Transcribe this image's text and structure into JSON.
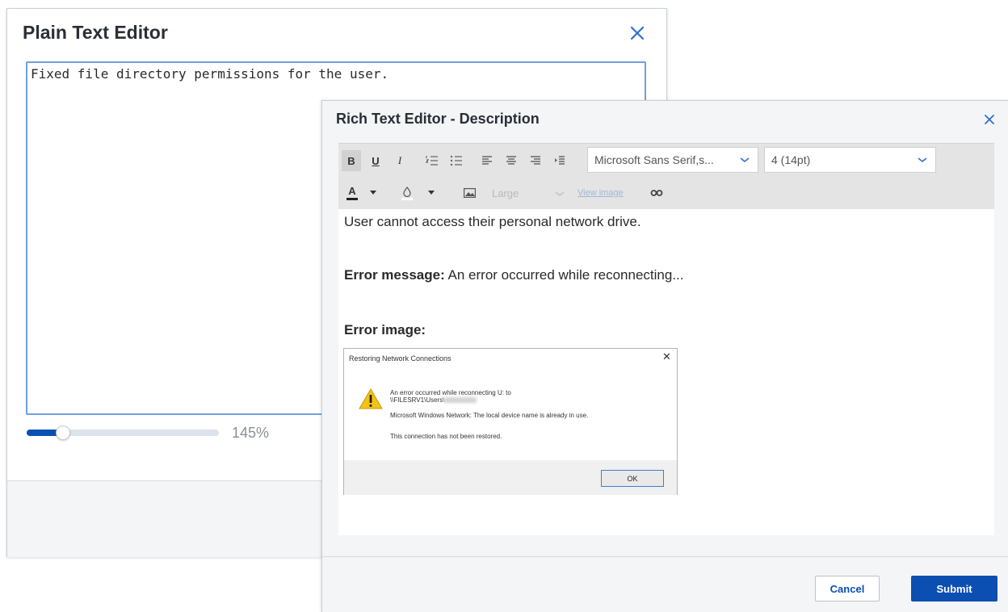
{
  "plain_editor": {
    "title": "Plain Text Editor",
    "text": "Fixed file directory permissions for the user.",
    "zoom": {
      "label": "145%",
      "slider_fraction": 0.19
    }
  },
  "rich_editor": {
    "title": "Rich Text Editor - Description",
    "toolbar": {
      "bold": "B",
      "underline": "U",
      "italic": "I",
      "font_family": "Microsoft Sans Serif,s...",
      "font_size": "4 (14pt)",
      "font_color": "A",
      "image_size": "Large",
      "view_image": "View image"
    },
    "body": {
      "line1": "User cannot access their personal network drive.",
      "error_message_label": "Error message:",
      "error_message_text": " An error occurred while reconnecting...",
      "error_image_label": "Error image:"
    },
    "error_dialog": {
      "title": "Restoring Network Connections",
      "line1": "An error occurred while reconnecting U: to",
      "line2": "\\\\FILESRV1\\Users\\",
      "line3": "Microsoft Windows Network: The local device name is already in use.",
      "line4": "This connection has not been restored.",
      "ok": "OK"
    },
    "footer": {
      "cancel": "Cancel",
      "submit": "Submit"
    }
  },
  "colors": {
    "accent": "#0b4fb3",
    "focus_border": "#6f9fe0"
  }
}
